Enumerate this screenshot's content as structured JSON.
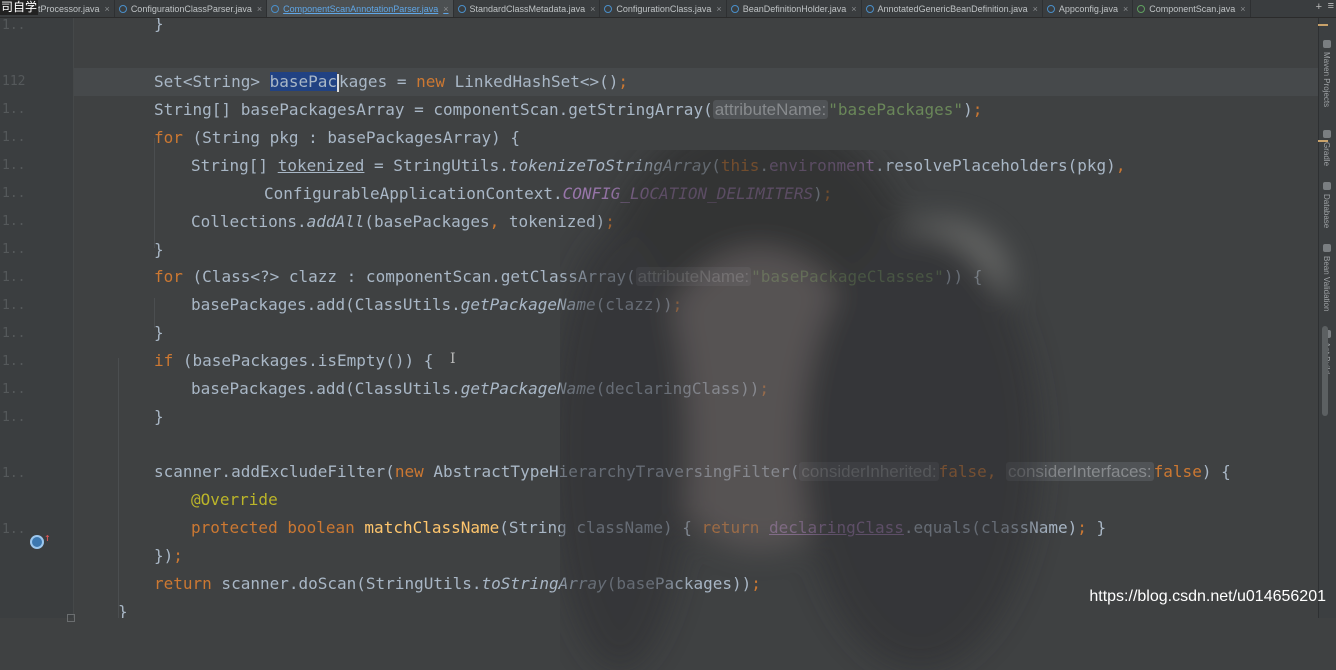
{
  "corner_text": "司自学",
  "tabs": [
    {
      "label": "ClassPostProcessor.java",
      "active": false
    },
    {
      "label": "ConfigurationClassParser.java",
      "active": false
    },
    {
      "label": "ComponentScanAnnotationParser.java",
      "active": true
    },
    {
      "label": "StandardClassMetadata.java",
      "active": false
    },
    {
      "label": "ConfigurationClass.java",
      "active": false
    },
    {
      "label": "BeanDefinitionHolder.java",
      "active": false
    },
    {
      "label": "AnnotatedGenericBeanDefinition.java",
      "active": false
    },
    {
      "label": "Appconfig.java",
      "active": false
    },
    {
      "label": "ComponentScan.java",
      "active": false
    }
  ],
  "tab_close": "×",
  "tab_overflow": "+",
  "tab_menu": "≡",
  "gutter_numbers": [
    "1..",
    "112",
    "1..",
    "1..",
    "1..",
    "1..",
    "1..",
    "1..",
    "1..",
    "1..",
    "1..",
    "1..",
    "1..",
    "1..",
    "1..",
    "1..",
    "1..",
    "1..",
    "1..",
    "1..",
    "1..",
    "1.."
  ],
  "code": {
    "l0_brace": "}",
    "l2_type": "Set<String> ",
    "l2_var_sel": "basePac",
    "l2_var_rest": "kages",
    "l2_mid": " = ",
    "l2_new": "new",
    "l2_tail": " LinkedHashSet<>()",
    "l2_semi": ";",
    "l3_a": "String[] basePackagesArray = componentScan.getStringArray(",
    "l3_hint": "attributeName:",
    "l3_str": "\"basePackages\"",
    "l3_b": ")",
    "l3_semi": ";",
    "l4_for": "for",
    "l4_rest": " (String pkg : basePackagesArray) {",
    "l5_a": "String[] ",
    "l5_var": "tokenized",
    "l5_b": " = StringUtils.",
    "l5_m": "tokenizeToStringArray",
    "l5_c": "(",
    "l5_this": "this",
    "l5_dot": ".",
    "l5_env": "environment",
    "l5_d": ".resolvePlaceholders(pkg)",
    "l5_comma": ",",
    "l6_a": "ConfigurableApplicationContext.",
    "l6_const": "CONFIG_LOCATION_DELIMITERS",
    "l6_b": ")",
    "l6_semi": ";",
    "l7_a": "Collections.",
    "l7_m": "addAll",
    "l7_b": "(basePackages",
    "l7_comma": ",",
    "l7_c": " tokenized)",
    "l7_semi": ";",
    "l8_brace": "}",
    "l9_for": "for",
    "l9_a": " (Class<?> clazz : componentScan.getClassArray(",
    "l9_hint": "attributeName:",
    "l9_str": "\"basePackageClasses\"",
    "l9_b": ")) {",
    "l10_a": "basePackages.add(ClassUtils.",
    "l10_m": "getPackageName",
    "l10_b": "(clazz))",
    "l10_semi": ";",
    "l11_brace": "}",
    "l12_if": "if",
    "l12_rest": " (basePackages.isEmpty()) {",
    "l13_a": "basePackages.add(ClassUtils.",
    "l13_m": "getPackageName",
    "l13_b": "(declaringClass))",
    "l13_semi": ";",
    "l14_brace": "}",
    "l16_a": "scanner.addExcludeFilter(",
    "l16_new": "new",
    "l16_b": " AbstractTypeHierarchyTraversingFilter(",
    "l16_hint1": "considerInherited:",
    "l16_false1": "false",
    "l16_comma": ",",
    "l16_hint2": "considerInterfaces:",
    "l16_false2": "false",
    "l16_c": ") {",
    "l17_ann": "@Override",
    "l18_prot": "protected",
    "l18_bool": "boolean",
    "l18_fn": "matchClassName",
    "l18_a": "(String className) { ",
    "l18_ret": "return",
    "l18_var": "declaringClass",
    "l18_b": ".equals(className)",
    "l18_semi": ";",
    "l18_c": " }",
    "l19_a": "})",
    "l19_semi": ";",
    "l20_ret": "return",
    "l20_a": " scanner.doScan(StringUtils.",
    "l20_m": "toStringArray",
    "l20_b": "(basePackages))",
    "l20_semi": ";",
    "l21_brace": "}"
  },
  "right_tools": [
    "Maven Projects",
    "Gradle",
    "Database",
    "Bean Validation",
    "Ant Build"
  ],
  "watermark": "https://blog.csdn.net/u014656201",
  "colors": {
    "background": "#3f4142",
    "keyword": "#cc7832",
    "string": "#6a8759",
    "field": "#9876aa",
    "method": "#ffc66d",
    "annotation": "#bbb529",
    "selection": "#214283",
    "active_tab": "#5fa6e6"
  }
}
